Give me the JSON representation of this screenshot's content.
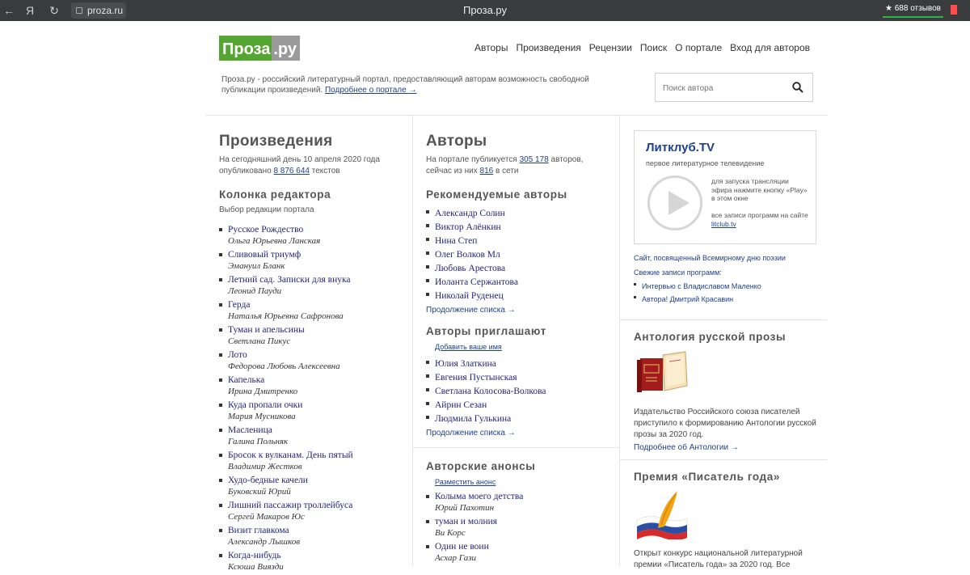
{
  "browser": {
    "back_icon": "←",
    "yandex_icon": "Я",
    "reload_icon": "↻",
    "url": "proza.ru",
    "tab_title": "Проза.ру",
    "reviews": "688 отзывов"
  },
  "header": {
    "logo_part1": "Проза",
    "logo_part2": ".ру",
    "nav": [
      "Авторы",
      "Произведения",
      "Рецензии",
      "Поиск",
      "О портале",
      "Вход для авторов"
    ],
    "intro_text": "Проза.ру - российский литературный портал, предоставляющий авторам возможность свободной публикации произведений.",
    "intro_link": "Подробнее о портале →",
    "search_placeholder": "Поиск автора"
  },
  "works": {
    "title": "Произведения",
    "stats_line1": "На сегодняшний день 10 апреля 2020 года",
    "stats_pre": "опубликовано",
    "stats_count": "8 876 644",
    "stats_post": "текстов",
    "editor_title": "Колонка редактора",
    "editor_sub": "Выбор редакции портала",
    "items": [
      {
        "title": "Русское Рождество",
        "author": "Ольга Юрьевна Ланская"
      },
      {
        "title": "Сливовый триумф",
        "author": "Эмануил Бланк"
      },
      {
        "title": "Летний сад. Записки для внука",
        "author": "Леонид Пауди"
      },
      {
        "title": "Герда",
        "author": "Наталья Юрьевна Сафронова"
      },
      {
        "title": "Туман и апельсины",
        "author": "Светлана Пикус"
      },
      {
        "title": "Лото",
        "author": "Федорова Любовь Алексеевна"
      },
      {
        "title": "Капелька",
        "author": "Ирина Дмитренко"
      },
      {
        "title": "Куда пропали очки",
        "author": "Мария Мусникова"
      },
      {
        "title": "Масленица",
        "author": "Галина Польняк"
      },
      {
        "title": "Бросок к вулканам. День пятый",
        "author": "Владимир Жестков"
      },
      {
        "title": "Худо-бедные качели",
        "author": "Буковский Юрий"
      },
      {
        "title": "Лишний пассажир троллейбуса",
        "author": "Сергей Макаров Юс"
      },
      {
        "title": "Визит главкома",
        "author": "Александр Лышков"
      },
      {
        "title": "Когда-нибудь",
        "author": "Ксюша Виязди"
      }
    ]
  },
  "authors": {
    "title": "Авторы",
    "stats_pre": "На портале публикуется",
    "stats_count": "305 178",
    "stats_mid": "авторов,",
    "stats_line2_pre": "сейчас из них",
    "online_count": "816",
    "stats_line2_post": "в сети",
    "recommended_title": "Рекомендуемые авторы",
    "recommended": [
      "Александр Солин",
      "Виктор Алёнкин",
      "Нина Степ",
      "Олег Волков Мл",
      "Любовь Арестова",
      "Иоланта Сержантова",
      "Николай Руденец"
    ],
    "more_link": "Продолжение списка →",
    "invite_title": "Авторы приглашают",
    "invite_add": "Добавить ваше имя",
    "invite": [
      "Юлия Златкина",
      "Евгения Пустынская",
      "Светлана Колосова-Волкова",
      "Айрин Сезан",
      "Людмила Гулькина"
    ],
    "more_link2": "Продолжение списка →",
    "anons_title": "Авторские анонсы",
    "anons_add": "Разместить анонс",
    "anons": [
      {
        "title": "Колыма моего детства",
        "author": "Юрий Пахотин"
      },
      {
        "title": "туман и молния",
        "author": "Ви Корс"
      },
      {
        "title": "Один не воин",
        "author": "Асхар Гази"
      }
    ]
  },
  "right": {
    "litclub_title": "Литклуб.TV",
    "litclub_sub": "первое литературное телевидение",
    "play_text": "для запуска трансляции эфира нажмите кнопку «Play» в этом окне",
    "records_pre": "все записи программ на сайте",
    "records_link": "litclub.tv",
    "poetry_link": "Сайт, посвященный Всемирному дню поэзии",
    "fresh_label": "Свежие записи программ:",
    "fresh": [
      "Интервью с Владиславом Маленко",
      "Автора! Дмитрий Красавин"
    ],
    "anthology_title": "Антология русской прозы",
    "anthology_text": "Издательство Российского союза писателей приступило к формированию Антологии русской прозы за 2020 год.",
    "anthology_link": "Подробнее об Антологии →",
    "prize_title": "Премия «Писатель года»",
    "prize_text": "Открыт конкурс национальной литературной премии «Писатель года» за 2020 год. Все"
  }
}
